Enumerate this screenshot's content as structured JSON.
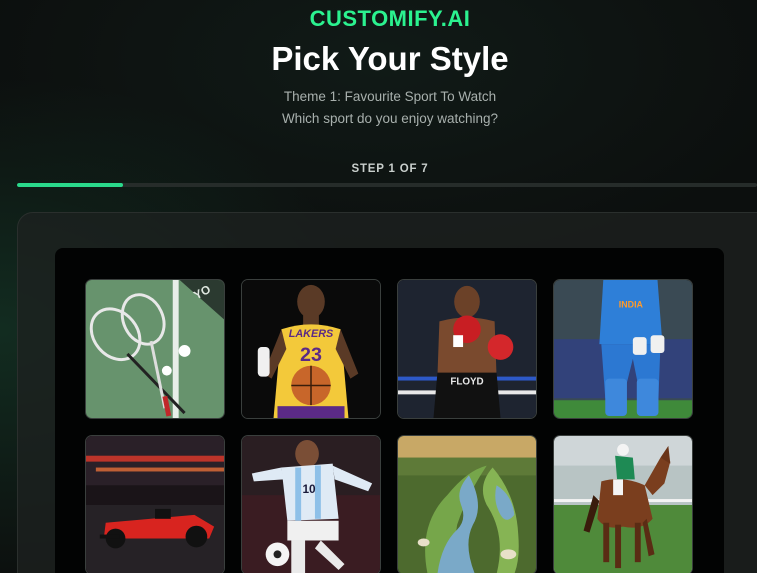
{
  "header": {
    "brand": "CUSTOMIFY.AI",
    "title": "Pick Your Style",
    "theme_line": "Theme 1: Favourite Sport To Watch",
    "question": "Which sport do you enjoy watching?"
  },
  "progress": {
    "label": "STEP 1 OF 7",
    "current": 1,
    "total": 7,
    "fraction": 0.143
  },
  "colors": {
    "brand": "#2bf28f",
    "progress_fill": "#2ad98b",
    "background": "#0c0f0e"
  },
  "options": [
    {
      "id": "badminton",
      "image": "badminton rackets and shuttlecock on court"
    },
    {
      "id": "basketball",
      "image": "basketball player in yellow Lakers 23 jersey holding a ball",
      "jersey_text": "LAKERS",
      "jersey_number": "23"
    },
    {
      "id": "boxing",
      "image": "boxer with red gloves in ring",
      "trunks_text": "FLOYD"
    },
    {
      "id": "cricket",
      "image": "cricket batsman in blue India jersey",
      "jersey_text": "INDIA"
    },
    {
      "id": "formula-one",
      "image": "red Formula 1 car racing at night"
    },
    {
      "id": "football",
      "image": "football player in Argentina jersey kicking a ball",
      "jersey_number": "10"
    },
    {
      "id": "golf",
      "image": "aerial view of a golf course with water"
    },
    {
      "id": "horse-racing",
      "image": "jockey riding a brown racehorse"
    }
  ]
}
